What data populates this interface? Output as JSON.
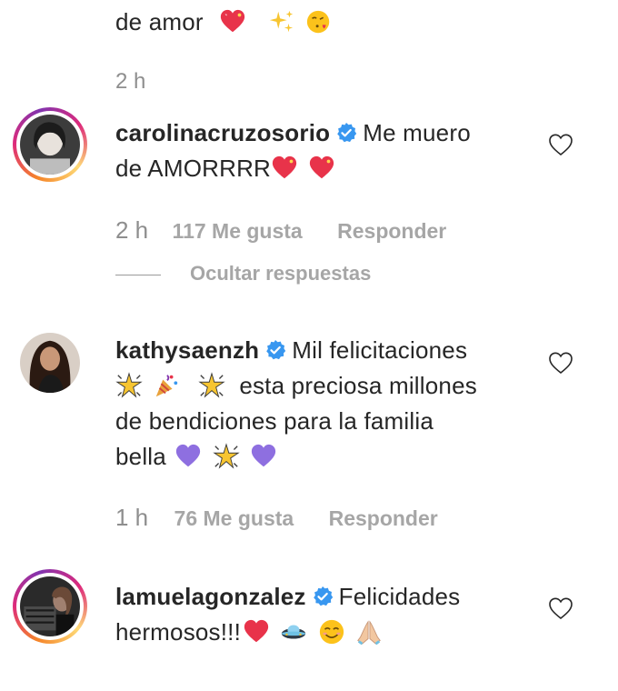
{
  "previous_comment": {
    "text_tail": "de amor",
    "emojis": [
      "sparkling-heart-icon",
      "sparkles-icon",
      "face-blowing-kiss-icon"
    ],
    "time": "2 h"
  },
  "comments": [
    {
      "username": "carolinacruzosorio",
      "verified": true,
      "text_line1": "Me muero",
      "text_line2": "de AMORRRR",
      "emojis": [
        "sparkling-heart-icon",
        "sparkling-heart-icon"
      ],
      "time": "2 h",
      "likes": "117 Me gusta",
      "reply_label": "Responder",
      "hide_replies_label": "Ocultar respuestas"
    },
    {
      "username": "kathysaenzh",
      "verified": true,
      "text_line1": "Mil felicitaciones",
      "text_line2": "esta preciosa millones",
      "text_line3": "de bendiciones para la familia",
      "text_line4": "bella",
      "emojis": [
        "glowing-star-icon",
        "party-popper-icon",
        "glowing-star-icon",
        "purple-heart-icon",
        "glowing-star-icon",
        "purple-heart-icon"
      ],
      "time": "1 h",
      "likes": "76 Me gusta",
      "reply_label": "Responder"
    },
    {
      "username": "lamuelagonzalez",
      "verified": true,
      "text_line1": "Felicidades",
      "text_line2": "hermosos!!!",
      "emojis": [
        "red-heart-icon",
        "ufo-icon",
        "smiling-face-icon",
        "folded-hands-icon"
      ]
    }
  ],
  "colors": {
    "text": "#262626",
    "secondary": "#8e8e8e",
    "verified_blue": "#3897f0",
    "story_ring_start": "#f58529",
    "story_ring_end": "#dd2a7b"
  }
}
